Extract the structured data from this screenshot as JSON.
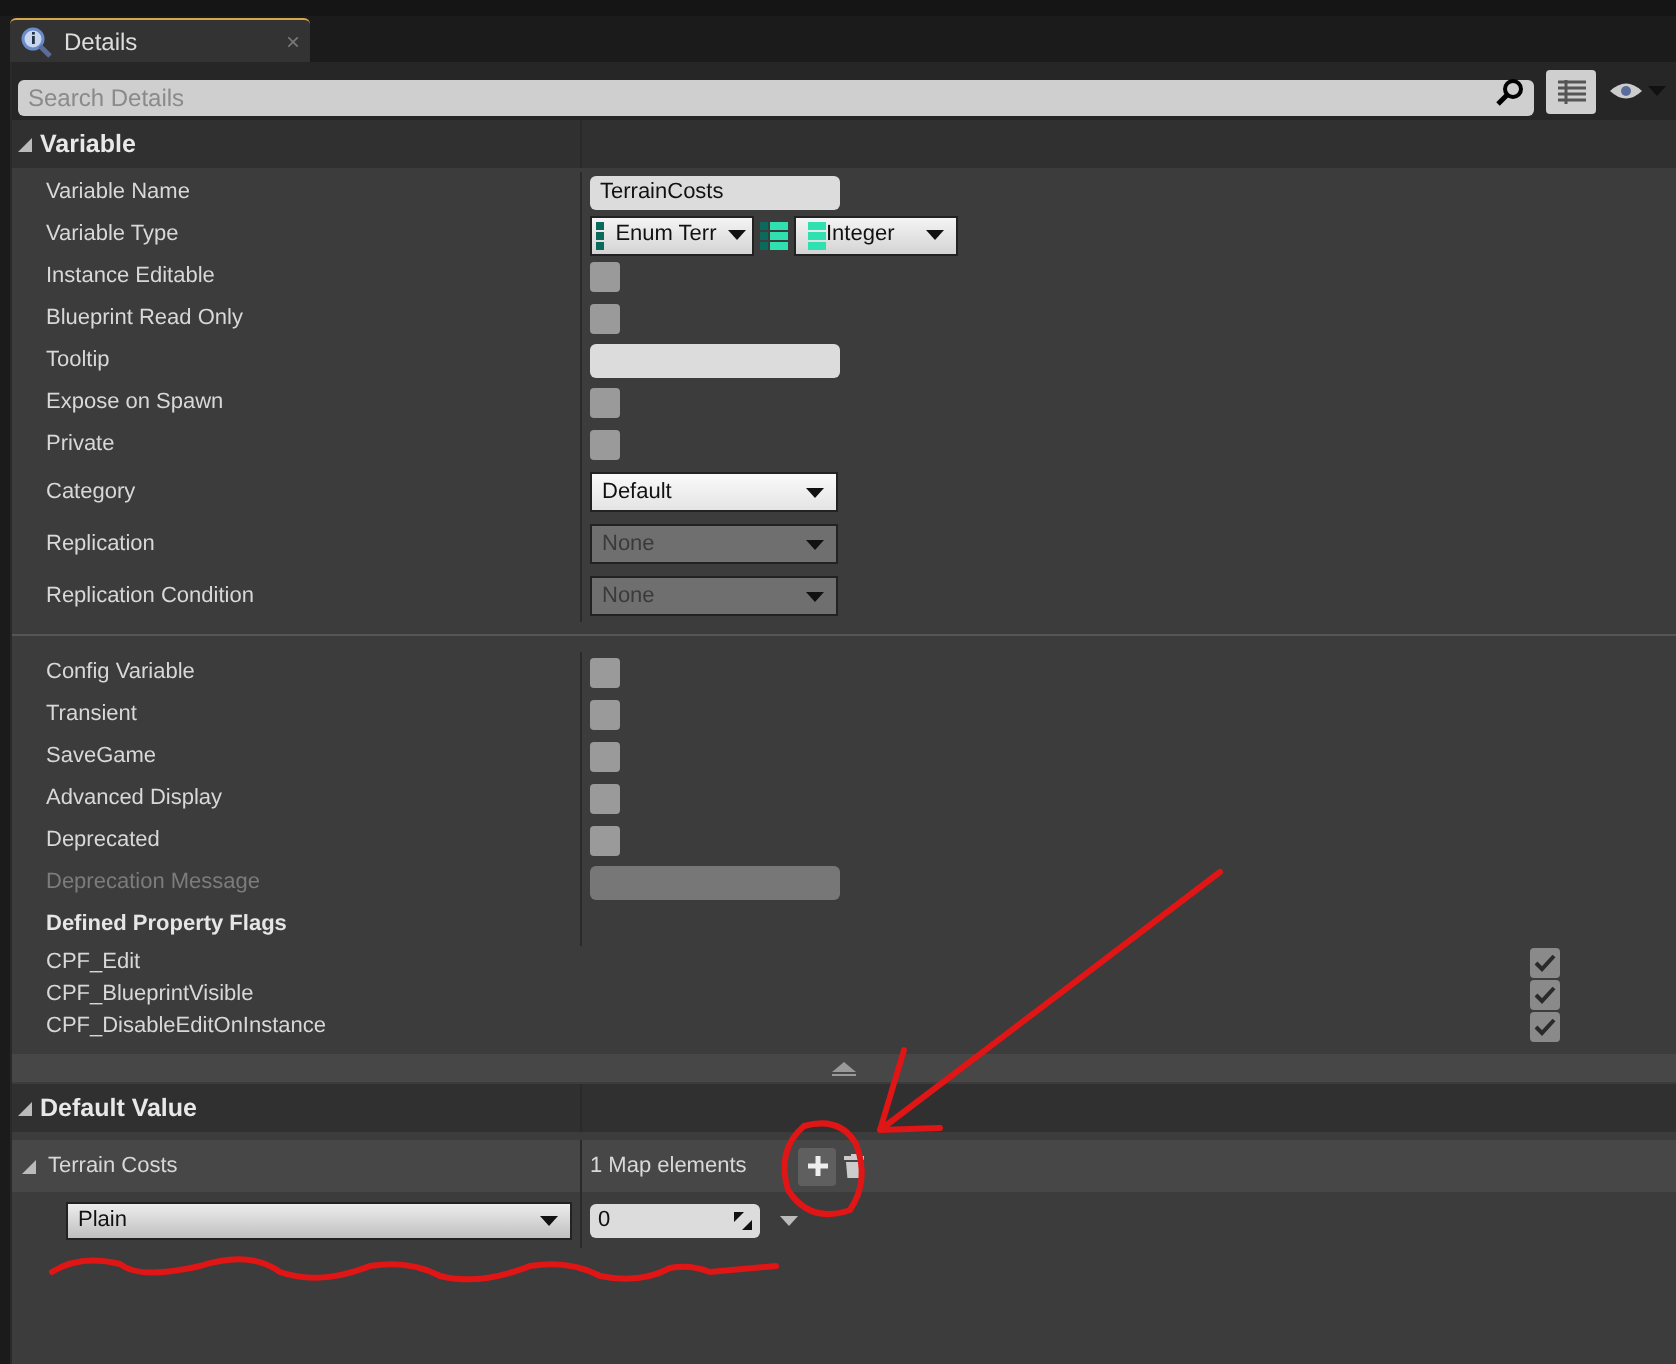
{
  "tab": {
    "label": "Details",
    "close": "×"
  },
  "search": {
    "placeholder": "Search Details"
  },
  "sections": [
    {
      "title": "Variable",
      "expanded": true,
      "groups": [
        [
          {
            "kind": "text",
            "label": "Variable Name",
            "value": "TerrainCosts"
          },
          {
            "kind": "type",
            "label": "Variable Type",
            "key_type": "Enum Terr",
            "value_type": "Integer"
          },
          {
            "kind": "checkbox",
            "label": "Instance Editable",
            "checked": false
          },
          {
            "kind": "checkbox",
            "label": "Blueprint Read Only",
            "checked": false
          },
          {
            "kind": "text",
            "label": "Tooltip"
          },
          {
            "kind": "checkbox",
            "label": "Expose on Spawn",
            "checked": false
          },
          {
            "kind": "checkbox",
            "label": "Private",
            "checked": false
          },
          {
            "kind": "combo",
            "label": "Category",
            "value": "Default",
            "disabled": false
          },
          {
            "kind": "combo",
            "label": "Replication",
            "value": "None",
            "disabled": true
          },
          {
            "kind": "combo",
            "label": "Replication Condition",
            "value": "None",
            "disabled": true
          }
        ],
        [
          {
            "kind": "checkbox",
            "label": "Config Variable",
            "checked": false
          },
          {
            "kind": "checkbox",
            "label": "Transient",
            "checked": false
          },
          {
            "kind": "checkbox",
            "label": "SaveGame",
            "checked": false
          },
          {
            "kind": "checkbox",
            "label": "Advanced Display",
            "checked": false
          },
          {
            "kind": "checkbox",
            "label": "Deprecated",
            "checked": false
          },
          {
            "kind": "text",
            "label": "Deprecation Message",
            "disabled": true
          },
          {
            "kind": "heading",
            "label": "Defined Property Flags"
          },
          {
            "kind": "flag",
            "label": "CPF_Edit",
            "checked": true
          },
          {
            "kind": "flag",
            "label": "CPF_BlueprintVisible",
            "checked": true
          },
          {
            "kind": "flag",
            "label": "CPF_DisableEditOnInstance",
            "checked": true
          }
        ]
      ]
    },
    {
      "title": "Default Value",
      "expanded": true,
      "map": {
        "label": "Terrain Costs",
        "expanded": true,
        "count": "1 Map elements",
        "entries": [
          {
            "key": "Plain",
            "value": "0"
          }
        ]
      }
    }
  ]
}
